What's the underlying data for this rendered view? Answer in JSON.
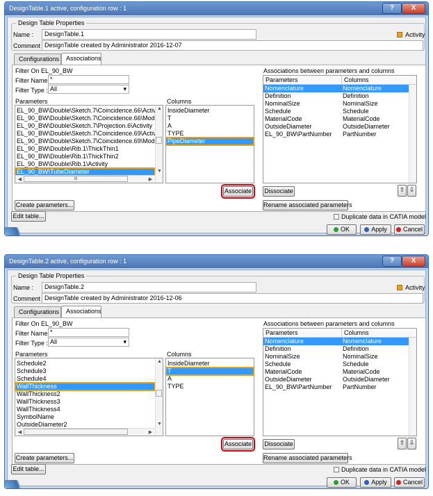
{
  "dialogs": [
    {
      "title": "DesignTable.1 active, configuration row : 1",
      "help_label": "?",
      "close_label": "X",
      "group_label": "Design Table Properties",
      "name_label": "Name :",
      "name_value": "DesignTable.1",
      "activity_label": "Activity",
      "comment_label": "Comment :",
      "comment_value": "DesignTable created by Administrator 2016-12-07",
      "tabs": [
        "Configurations",
        "Associations"
      ],
      "filter_on": "Filter On EL_90_BW",
      "filter_name_label": "Filter Name :",
      "filter_name_value": "*",
      "filter_type_label": "Filter Type :",
      "filter_type_value": "All",
      "parameters_label": "Parameters",
      "parameters": [
        "EL_90_BW\\Double\\Sketch.7\\Coincidence.66\\Activity",
        "EL_90_BW\\Double\\Sketch.7\\Coincidence.66\\Mode",
        "EL_90_BW\\Double\\Sketch.7\\Projection.6\\Activity",
        "EL_90_BW\\Double\\Sketch.7\\Coincidence.69\\Activity",
        "EL_90_BW\\Double\\Sketch.7\\Coincidence.69\\Mode",
        "EL_90_BW\\Double\\Rib.1\\ThickThin1",
        "EL_90_BW\\Double\\Rib.1\\ThickThin2",
        "EL_90_BW\\Double\\Rib.1\\Activity",
        "EL_90_BW\\TubeDiameter"
      ],
      "parameters_selected": 8,
      "hscroll_mid": "III",
      "columns_label": "Columns",
      "columns": [
        "InsideDiameter",
        "T",
        "A",
        "TYPE",
        "PipeDiameter"
      ],
      "columns_selected": 4,
      "assoc_label": "Associations between parameters and columns",
      "assoc_headers": [
        "Parameters",
        "Columns"
      ],
      "assoc_rows": [
        [
          "Nomenclature",
          "Nomenclature"
        ],
        [
          "Definition",
          "Definition"
        ],
        [
          "NominalSize",
          "NominalSize"
        ],
        [
          "Schedule",
          "Schedule"
        ],
        [
          "MaterialCode",
          "MaterialCode"
        ],
        [
          "OutsideDiameter",
          "OutsideDiameter"
        ],
        [
          "EL_90_BW\\PartNumber",
          "PartNumber"
        ]
      ],
      "associate": "Associate",
      "dissociate": "Dissociate",
      "create_params": "Create parameters...",
      "rename_params": "Rename associated parameters",
      "edit_table": "Edit table...",
      "duplicate": "Duplicate data in CATIA model",
      "ok": "OK",
      "apply": "Apply",
      "cancel": "Cancel"
    },
    {
      "title": "DesignTable.2 active, configuration row : 1",
      "help_label": "?",
      "close_label": "X",
      "group_label": "Design Table Properties",
      "name_label": "Name :",
      "name_value": "DesignTable.2",
      "activity_label": "Activity",
      "comment_label": "Comment :",
      "comment_value": "DesignTable created by Administrator 2016-12-06",
      "tabs": [
        "Configurations",
        "Associations"
      ],
      "filter_on": "Filter On EL_90_BW",
      "filter_name_label": "Filter Name :",
      "filter_name_value": "*",
      "filter_type_label": "Filter Type :",
      "filter_type_value": "All",
      "parameters_label": "Parameters",
      "parameters": [
        "Schedule2",
        "Schedule3",
        "Schedule4",
        "WallThickness",
        "WallThickness2",
        "WallThickness3",
        "WallThickness4",
        "SymbolName",
        "OutsideDiameter2"
      ],
      "parameters_selected": 3,
      "hscroll_mid": "",
      "columns_label": "Columns",
      "columns": [
        "InsideDiameter",
        "T",
        "A",
        "TYPE"
      ],
      "columns_selected": 1,
      "assoc_label": "Associations between parameters and columns",
      "assoc_headers": [
        "Parameters",
        "Columns"
      ],
      "assoc_rows": [
        [
          "Nomenclature",
          "Nomenclature"
        ],
        [
          "Definition",
          "Definition"
        ],
        [
          "NominalSize",
          "NominalSize"
        ],
        [
          "Schedule",
          "Schedule"
        ],
        [
          "MaterialCode",
          "MaterialCode"
        ],
        [
          "OutsideDiameter",
          "OutsideDiameter"
        ],
        [
          "EL_90_BW\\PartNumber",
          "PartNumber"
        ]
      ],
      "associate": "Associate",
      "dissociate": "Dissociate",
      "create_params": "Create parameters...",
      "rename_params": "Rename associated parameters",
      "edit_table": "Edit table...",
      "duplicate": "Duplicate data in CATIA model",
      "ok": "OK",
      "apply": "Apply",
      "cancel": "Cancel"
    }
  ],
  "colors": {
    "selection": "#3399ff",
    "highlight_orange": "#f0a000",
    "highlight_red": "#d00010",
    "titlebar": "#4a74b4"
  },
  "icons": [
    "activity-checkbox-icon",
    "move-up-icon",
    "move-down-icon",
    "ok-dot-icon",
    "apply-dot-icon",
    "cancel-dot-icon"
  ]
}
